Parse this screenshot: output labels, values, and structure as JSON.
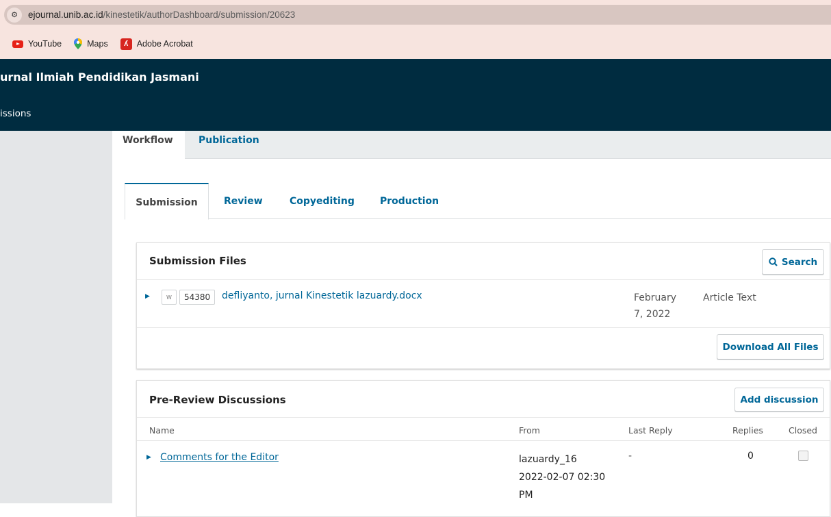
{
  "browser": {
    "url_host": "ejournal.unib.ac.id",
    "url_path": "/kinestetik/authorDashboard/submission/20623",
    "bookmarks": [
      "YouTube",
      "Maps",
      "Adobe Acrobat"
    ]
  },
  "header": {
    "journal_name": "urnal Ilmiah Pendidikan Jasmani",
    "nav_item": "issions"
  },
  "top_tabs": [
    "Workflow",
    "Publication"
  ],
  "stage_tabs": [
    "Submission",
    "Review",
    "Copyediting",
    "Production"
  ],
  "submission_files": {
    "title": "Submission Files",
    "search_label": "Search",
    "file": {
      "id": "54380",
      "name": "defliyanto, jurnal Kinestetik lazuardy.docx",
      "date_line1": "February",
      "date_line2": "7, 2022",
      "type": "Article Text"
    },
    "download_all_label": "Download All Files"
  },
  "discussions": {
    "title": "Pre-Review Discussions",
    "add_label": "Add discussion",
    "columns": [
      "Name",
      "From",
      "Last Reply",
      "Replies",
      "Closed"
    ],
    "rows": [
      {
        "name": "Comments for the Editor",
        "from_user": "lazuardy_16",
        "from_date": "2022-02-07 02:30",
        "from_time": "PM",
        "last_reply": "-",
        "replies": "0",
        "closed": false
      }
    ]
  },
  "colors": {
    "header_bg": "#002c40",
    "link": "#006798",
    "chrome": "#f7e4df"
  }
}
